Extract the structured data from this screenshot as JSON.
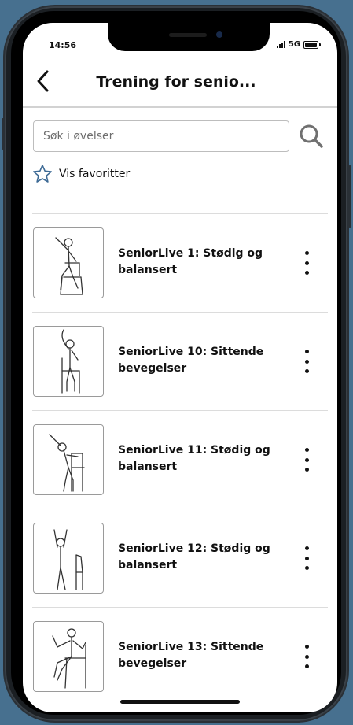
{
  "status_bar": {
    "time": "14:56",
    "network": "5G"
  },
  "header": {
    "title": "Trening for senio..."
  },
  "search": {
    "placeholder": "Søk i øvelser"
  },
  "favorites": {
    "label": "Vis favoritter"
  },
  "exercises": [
    {
      "label": "SeniorLive 1: Stødig og balansert"
    },
    {
      "label": "SeniorLive 10: Sittende bevegelser"
    },
    {
      "label": "SeniorLive 11: Stødig og balansert"
    },
    {
      "label": "SeniorLive 12: Stødig og balansert"
    },
    {
      "label": "SeniorLive 13: Sittende bevegelser"
    }
  ],
  "colors": {
    "background": "#47708f",
    "star_outline": "#3d6a95"
  }
}
